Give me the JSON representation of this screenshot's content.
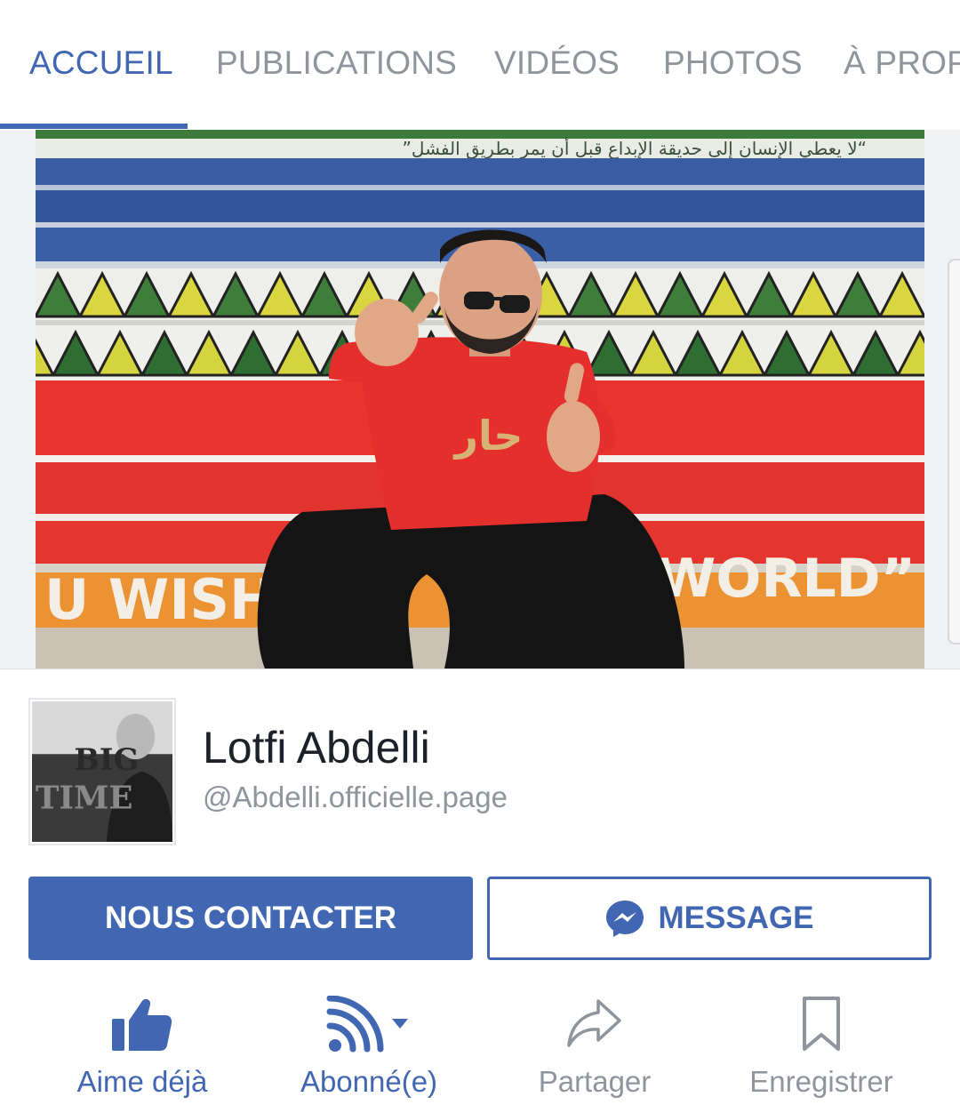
{
  "tabs": [
    {
      "label": "ACCUEIL",
      "active": true
    },
    {
      "label": "PUBLICATIONS",
      "active": false
    },
    {
      "label": "VIDÉOS",
      "active": false
    },
    {
      "label": "PHOTOS",
      "active": false
    },
    {
      "label": "À PROPOS",
      "active": false
    }
  ],
  "cover": {
    "arabic_text": "”لا يعطي الإنسان إلى حديقة الإبداع قبل أن يمر بطريق الفشل“",
    "shirt_text": "حار",
    "banner_left": "U WISH",
    "banner_right": "E WORLD”"
  },
  "profile": {
    "name": "Lotfi Abdelli",
    "handle": "@Abdelli.officielle.page",
    "avatar_text_1": "BIG",
    "avatar_text_2": "TIME"
  },
  "buttons": {
    "contact_label": "NOUS CONTACTER",
    "message_label": "MESSAGE"
  },
  "actions": [
    {
      "label": "Aime déjà",
      "icon": "thumbs-up-icon"
    },
    {
      "label": "Abonné(e)",
      "icon": "rss-follow-icon"
    },
    {
      "label": "Partager",
      "icon": "share-arrow-icon"
    },
    {
      "label": "Enregistrer",
      "icon": "bookmark-icon"
    }
  ],
  "colors": {
    "brand_blue": "#4267b2",
    "muted_gray": "#90949c",
    "text_dark": "#1d2129"
  }
}
